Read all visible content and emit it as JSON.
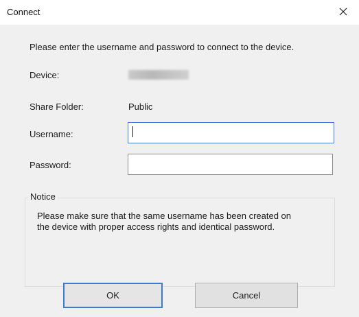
{
  "window": {
    "title": "Connect"
  },
  "dialog": {
    "intro": "Please enter the username and password to connect to the device.",
    "device_label": "Device:",
    "share_folder_label": "Share Folder:",
    "share_folder_value": "Public",
    "username_label": "Username:",
    "username_value": "",
    "password_label": "Password:",
    "password_value": ""
  },
  "notice": {
    "legend": "Notice",
    "text": "Please make sure that the same username has been created on the device with proper access rights and identical password."
  },
  "buttons": {
    "ok": "OK",
    "cancel": "Cancel"
  },
  "icons": {
    "close": "close-icon"
  },
  "colors": {
    "focus_accent": "#3b7bd6",
    "client_background": "#f0f0f0"
  }
}
